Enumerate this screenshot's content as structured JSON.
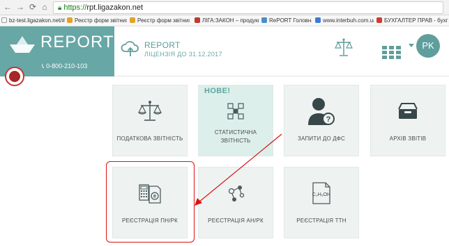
{
  "browser": {
    "url_scheme": "https://",
    "url_host": "rpt.ligazakon.net",
    "bookmarks": [
      {
        "label": "bz-test.ligazakon.net/#",
        "color": "#ffffff"
      },
      {
        "label": "Реєстр форм звітних д",
        "color": "#e5a22a"
      },
      {
        "label": "Реєстр форм звітних д",
        "color": "#e5a22a"
      },
      {
        "label": "ЛІГА:ЗАКОН – продукц",
        "color": "#c0392b"
      },
      {
        "label": "RePORT Головна",
        "color": "#4a8fc7"
      },
      {
        "label": "www.interbuh.com.ua/",
        "color": "#3b7bd6"
      },
      {
        "label": "БУХГАЛТЕР ПРАВ - бухг",
        "color": "#d13b2f"
      }
    ]
  },
  "header": {
    "brand_name": "REPORT",
    "phone": "0-800-210-103",
    "title": "REPORT",
    "license": "ЛІЦЕНЗІЯ ДО 31.12.2017",
    "avatar_initials": "PK",
    "accent_color": "#67a7a6"
  },
  "tiles": [
    {
      "label": "ПОДАТКОВА ЗВІТНІСТЬ",
      "icon": "scales-icon"
    },
    {
      "label": "СТАТИСТИЧНА ЗВІТНІСТЬ",
      "badge": "НОВЕ!",
      "icon": "statistics-icon"
    },
    {
      "label": "ЗАПИТИ ДО ДФС",
      "icon": "agent-question-icon"
    },
    {
      "label": "АРХІВ ЗВІТІВ",
      "icon": "archive-box-icon"
    },
    {
      "label": "РЕЄСТРАЦІЯ ПН/РК",
      "icon": "invoice-calculator-icon"
    },
    {
      "label": "РЕЄСТРАЦІЯ АН/РК",
      "icon": "molecules-icon"
    },
    {
      "label": "РЕЄСТРАЦІЯ ТТН",
      "icon": "ethanol-formula-icon",
      "formula": "C₂H₅OH"
    }
  ]
}
